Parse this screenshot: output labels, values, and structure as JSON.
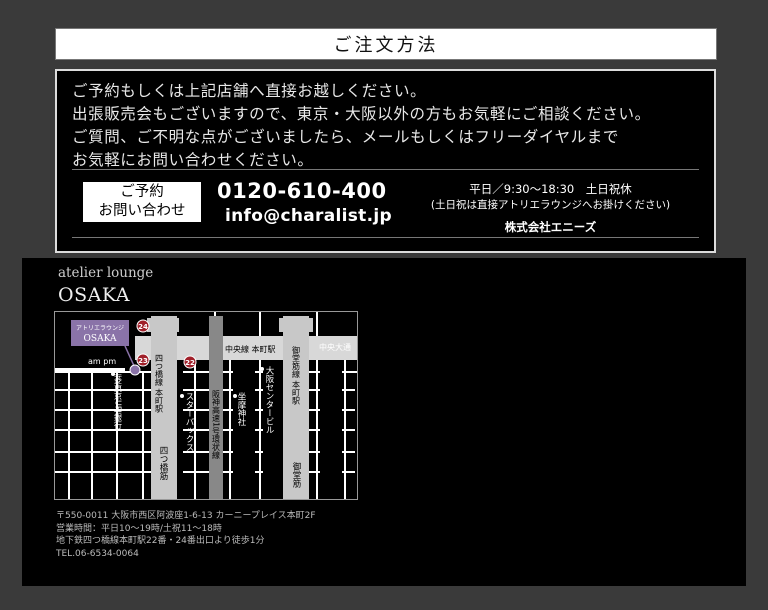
{
  "order_section": {
    "title": "ご注文方法",
    "intro_lines": [
      "ご予約もしくは上記店舗へ直接お越しください。",
      "出張販売会もございますので、東京・大阪以外の方もお気軽にご相談ください。",
      "ご質問、ご不明な点がございましたら、メールもしくはフリーダイヤルまで",
      "お気軽にお問い合わせください。"
    ],
    "badge_line1": "ご予約",
    "badge_line2": "お問い合わせ",
    "phone": "0120-610-400",
    "email": "info@charalist.jp",
    "hours": "平日／9:30〜18:30　土日祝休",
    "hours_note": "(土日祝は直接アトリエラウンジへお掛けください)",
    "company": "株式会社エニーズ"
  },
  "store": {
    "subtitle": "atelier lounge",
    "name": "OSAKA",
    "map": {
      "callout_line1": "アトリエラウンジ",
      "callout_line2": "OSAKA",
      "exit_24": "24",
      "exit_23": "23",
      "exit_22": "22",
      "ampm": "am pm",
      "bank": "三菱東京UFJ銀行",
      "station_yotsubashi": "四つ橋線 本町駅",
      "station_chuo": "中央線 本町駅",
      "station_midosuji": "御堂筋線 本町駅",
      "road_chuo": "中央大通",
      "starbucks": "スターバックス",
      "expressway": "阪神高速1号環状線",
      "osaka_center": "大阪センタービル",
      "zama": "坐摩神社",
      "yotsubashi_suji": "四つ橋筋",
      "midosuji": "御堂筋"
    },
    "address_lines": [
      "〒550-0011  大阪市西区阿波座1-6-13  カーニープレイス本町2F",
      "営業時間：平日10〜19時/土祝11〜18時",
      "地下鉄四つ橋線本町駅22番・24番出口より徒歩1分",
      "TEL.06-6534-0064"
    ]
  }
}
